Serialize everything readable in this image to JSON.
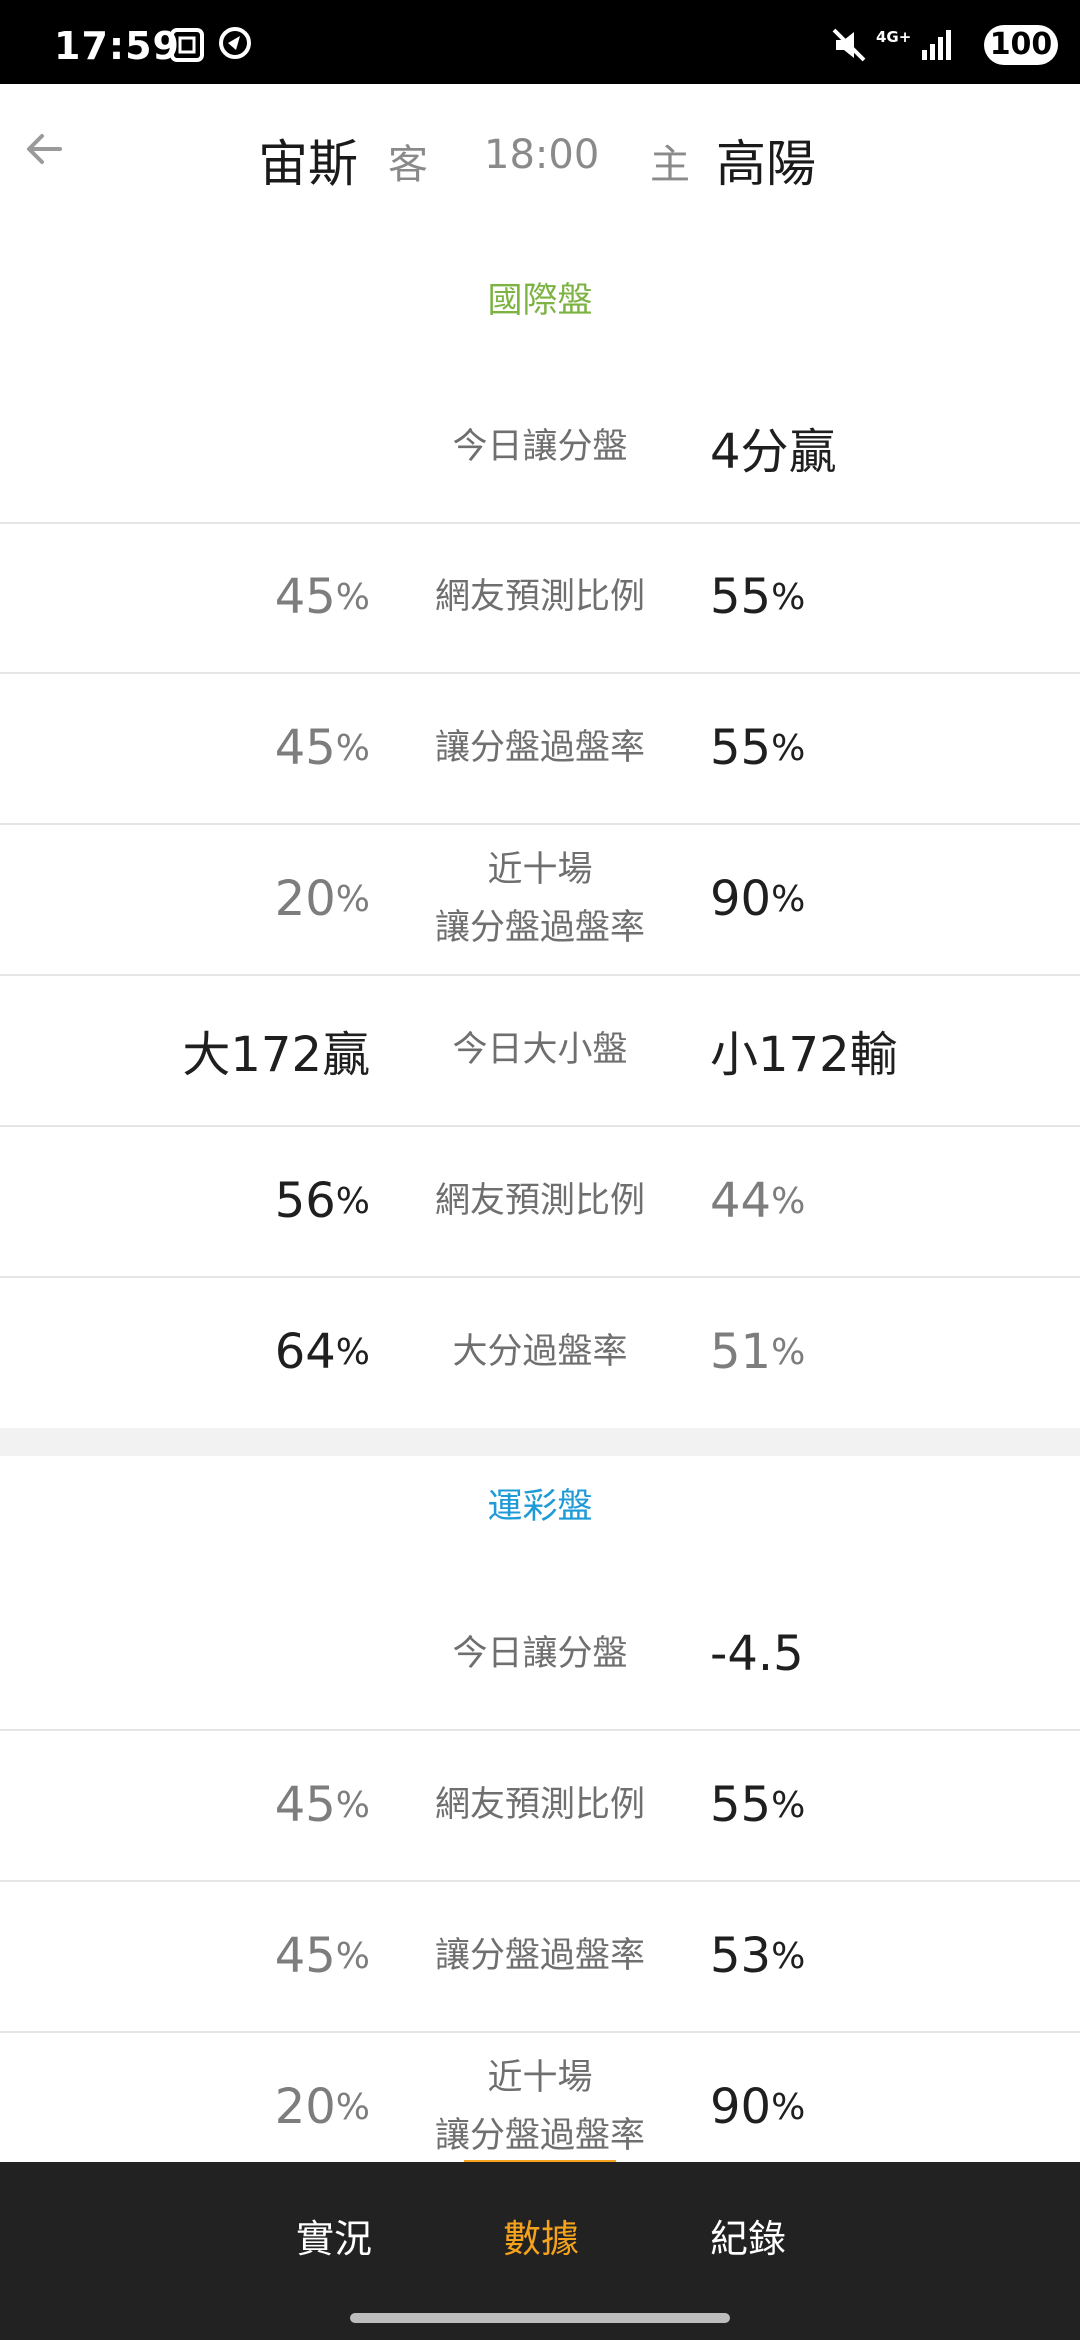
{
  "status_bar": {
    "time": "17:59",
    "network": "4G+",
    "battery": "100",
    "icons": [
      "screenshot-icon",
      "location-icon",
      "mute-icon",
      "signal-icon"
    ]
  },
  "header": {
    "away_team": "宙斯",
    "away_role": "客",
    "time": "18:00",
    "home_role": "主",
    "home_team": "高陽"
  },
  "international": {
    "title": "國際盤",
    "title_color": "#7cb342",
    "rows": [
      {
        "left": "",
        "left_unit": "",
        "label": "今日讓分盤",
        "label2": "",
        "right": "4分贏",
        "right_unit": ""
      },
      {
        "left": "45",
        "left_unit": "%",
        "label": "網友預測比例",
        "label2": "",
        "right": "55",
        "right_unit": "%"
      },
      {
        "left": "45",
        "left_unit": "%",
        "label": "讓分盤過盤率",
        "label2": "",
        "right": "55",
        "right_unit": "%"
      },
      {
        "left": "20",
        "left_unit": "%",
        "label": "近十場",
        "label2": "讓分盤過盤率",
        "right": "90",
        "right_unit": "%"
      },
      {
        "left": "大172贏",
        "left_unit": "",
        "label": "今日大小盤",
        "label2": "",
        "right": "小172輸",
        "right_unit": ""
      },
      {
        "left": "56",
        "left_unit": "%",
        "label": "網友預測比例",
        "label2": "",
        "right": "44",
        "right_unit": "%"
      },
      {
        "left": "64",
        "left_unit": "%",
        "label": "大分過盤率",
        "label2": "",
        "right": "51",
        "right_unit": "%"
      }
    ]
  },
  "sports_lottery": {
    "title": "運彩盤",
    "title_color": "#1e9bd7",
    "rows": [
      {
        "left": "",
        "left_unit": "",
        "label": "今日讓分盤",
        "label2": "",
        "right": "-4.5",
        "right_unit": ""
      },
      {
        "left": "45",
        "left_unit": "%",
        "label": "網友預測比例",
        "label2": "",
        "right": "55",
        "right_unit": "%"
      },
      {
        "left": "45",
        "left_unit": "%",
        "label": "讓分盤過盤率",
        "label2": "",
        "right": "53",
        "right_unit": "%"
      },
      {
        "left": "20",
        "left_unit": "%",
        "label": "近十場",
        "label2": "讓分盤過盤率",
        "right": "90",
        "right_unit": "%"
      }
    ]
  },
  "bottom_nav": {
    "tabs": [
      "實況",
      "數據",
      "紀錄"
    ],
    "active": "數據",
    "active_color": "#f5a21c"
  }
}
